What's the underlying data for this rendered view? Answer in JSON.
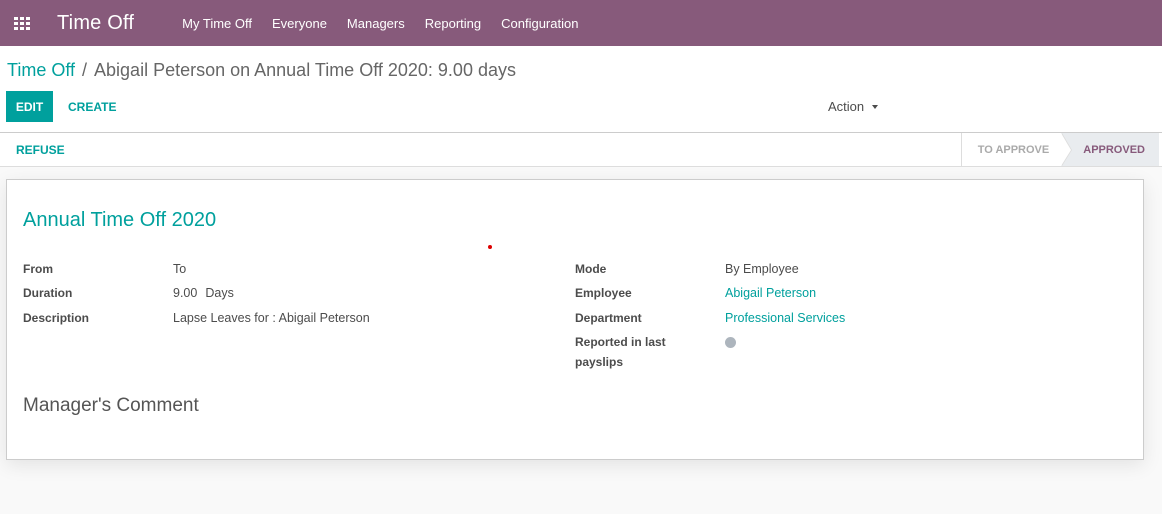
{
  "navbar": {
    "app_title": "Time Off",
    "menu": [
      "My Time Off",
      "Everyone",
      "Managers",
      "Reporting",
      "Configuration"
    ],
    "color": "#875a7b"
  },
  "breadcrumb": {
    "parent": "Time Off",
    "separator": "/",
    "current": "Abigail Peterson on Annual Time Off 2020: 9.00 days"
  },
  "toolbar": {
    "edit_label": "EDIT",
    "create_label": "CREATE",
    "action_label": "Action"
  },
  "statusbar": {
    "refuse_label": "REFUSE",
    "stages": [
      "TO APPROVE",
      "APPROVED"
    ],
    "active_stage": "APPROVED"
  },
  "form": {
    "title": "Annual Time Off 2020",
    "left_fields": {
      "from_label": "From",
      "from_value": "To",
      "duration_label": "Duration",
      "duration_value": "9.00",
      "duration_unit": "Days",
      "description_label": "Description",
      "description_value": "Lapse Leaves for : Abigail Peterson"
    },
    "right_fields": {
      "mode_label": "Mode",
      "mode_value": "By Employee",
      "employee_label": "Employee",
      "employee_value": "Abigail Peterson",
      "department_label": "Department",
      "department_value": "Professional Services",
      "reported_label_line1": "Reported in last",
      "reported_label_line2": "payslips",
      "reported_value": false
    },
    "manager_comment_title": "Manager's Comment"
  },
  "colors": {
    "accent": "#00a09d",
    "brand": "#875a7b"
  }
}
